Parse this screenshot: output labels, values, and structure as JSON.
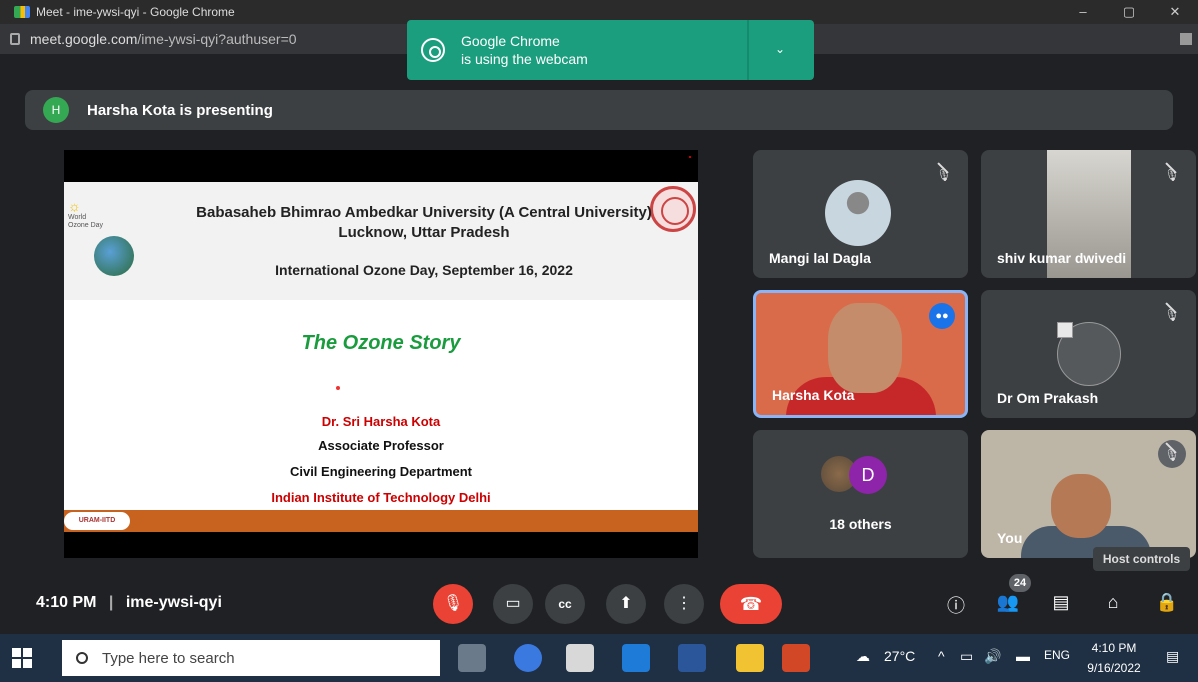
{
  "browser": {
    "window_title": "Meet - ime-ywsi-qyi - Google Chrome",
    "url_host": "meet.google.com",
    "url_path": "/ime-ywsi-qyi?authuser=0",
    "window_buttons": [
      "–",
      "▢",
      "✕"
    ]
  },
  "notification": {
    "line1": "Google Chrome",
    "line2": "is using the webcam",
    "chevron": "⌄"
  },
  "presenting_banner": {
    "avatar_letter": "H",
    "text": "Harsha Kota is presenting"
  },
  "slide": {
    "university": "Babasaheb Bhimrao Ambedkar University (A Central University)",
    "city": "Lucknow, Uttar Pradesh",
    "event": "International Ozone Day, September 16, 2022",
    "logo_text": "World Ozone Day",
    "title": "The Ozone Story",
    "presenter": "Dr. Sri Harsha Kota",
    "role": "Associate Professor",
    "department": "Civil Engineering Department",
    "institute": "Indian Institute of Technology Delhi",
    "footer_badge": "URAM-IITD"
  },
  "participants": [
    {
      "name": "Mangi lal Dagla",
      "muted": true
    },
    {
      "name": "shiv kumar dwivedi",
      "muted": true
    },
    {
      "name": "Harsha Kota",
      "muted": false,
      "speaking": true
    },
    {
      "name": "Dr Om Prakash",
      "muted": true
    },
    {
      "name": "18 others",
      "avatar_letter": "D"
    },
    {
      "name": "You",
      "muted": true
    }
  ],
  "host_controls_tooltip": "Host controls",
  "meeting": {
    "time": "4:10 PM",
    "separator": "|",
    "code": "ime-ywsi-qyi",
    "participant_count": "24"
  },
  "taskbar": {
    "search_placeholder": "Type here to search",
    "weather": "27°C",
    "lang": "ENG",
    "time": "4:10 PM",
    "date": "9/16/2022"
  },
  "colors": {
    "meet_bg": "#202124",
    "tile_bg": "#3c4043",
    "red": "#ea4335",
    "notify_green": "#1a9e7e",
    "speaking_blue": "#8ab4f8"
  }
}
